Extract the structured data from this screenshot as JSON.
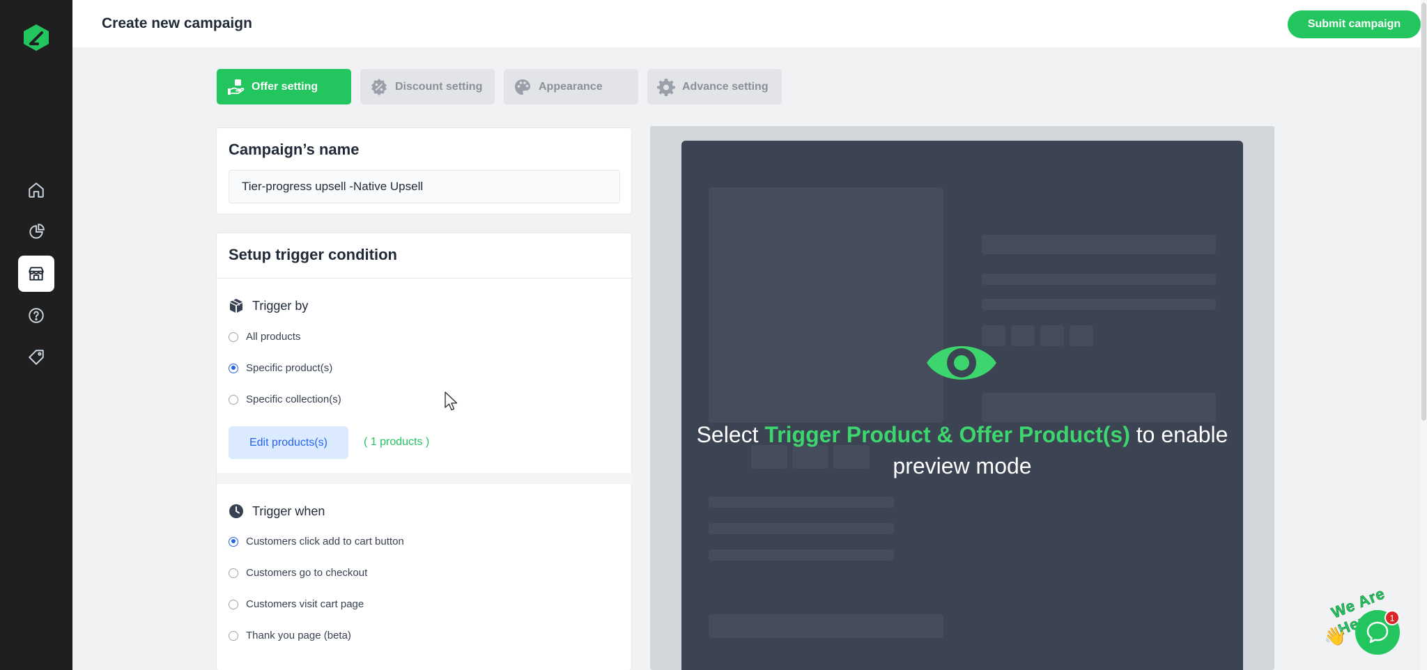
{
  "header": {
    "title": "Create new campaign",
    "submit_label": "Submit campaign"
  },
  "sidebar": {
    "items": [
      {
        "icon": "home-icon"
      },
      {
        "icon": "analytics-icon"
      },
      {
        "icon": "store-icon",
        "active": true
      },
      {
        "icon": "help-icon"
      },
      {
        "icon": "tag-icon"
      }
    ]
  },
  "tabs": [
    {
      "label": "Offer setting",
      "icon": "offer-hand-icon",
      "active": true
    },
    {
      "label": "Discount setting",
      "icon": "discount-icon"
    },
    {
      "label": "Appearance",
      "icon": "palette-icon"
    },
    {
      "label": "Advance setting",
      "icon": "gear-icon"
    }
  ],
  "campaign": {
    "title": "Campaign’s name",
    "name_value": "Tier-progress upsell -Native Upsell"
  },
  "trigger": {
    "title": "Setup trigger condition",
    "trigger_by": {
      "label": "Trigger by",
      "options": [
        "All products",
        "Specific product(s)",
        "Specific collection(s)"
      ],
      "selected": "Specific product(s)"
    },
    "edit_products_label": "Edit products(s)",
    "products_count": "( 1 products )",
    "trigger_when": {
      "label": "Trigger when",
      "options": [
        "Customers click add to cart button",
        "Customers go to checkout",
        "Customers visit cart page",
        "Thank you page (beta)"
      ],
      "selected": "Customers click add to cart button"
    }
  },
  "preview": {
    "msg_prefix": "Select ",
    "msg_highlight": "Trigger Product & Offer Product(s)",
    "msg_suffix": " to enable preview mode"
  },
  "chat": {
    "tagline": "We Are Here!",
    "badge_count": "1"
  },
  "colors": {
    "accent": "#22c55e",
    "sidebar": "#1f1f1f",
    "radio_checked": "#2563eb",
    "preview_bg": "#3c4352"
  }
}
